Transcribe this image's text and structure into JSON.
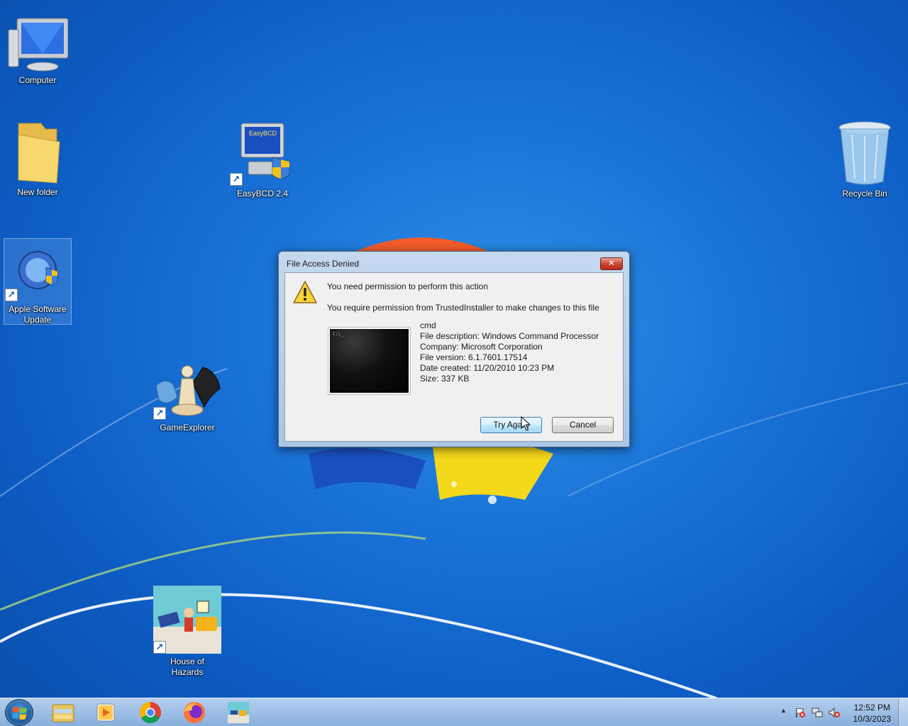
{
  "desktop": {
    "icons": [
      {
        "label": "Computer"
      },
      {
        "label": "New folder"
      },
      {
        "label": "EasyBCD 2.4",
        "badge": "EasyBCD"
      },
      {
        "label": "Recycle Bin"
      },
      {
        "label": "Apple Software Update"
      },
      {
        "label": "GameExplorer"
      },
      {
        "label": "House of Hazards"
      }
    ]
  },
  "dialog": {
    "title": "File Access Denied",
    "close_glyph": "✕",
    "message": "You need permission to perform this action",
    "submessage": "You require permission from TrustedInstaller to make changes to this file",
    "thumb_text": "C:\\_",
    "file": {
      "name": "cmd",
      "description": "File description: Windows Command Processor",
      "company": "Company: Microsoft Corporation",
      "version": "File version: 6.1.7601.17514",
      "created": "Date created: 11/20/2010 10:23 PM",
      "size": "Size: 337 KB"
    },
    "buttons": {
      "try_again": "Try Again",
      "cancel": "Cancel"
    }
  },
  "taskbar": {
    "pinned": [
      "windows-explorer",
      "windows-media-player",
      "google-chrome",
      "firefox",
      "house-of-hazards"
    ],
    "clock": {
      "time": "12:52 PM",
      "date": "10/3/2023"
    },
    "tray_arrow": "▲"
  }
}
